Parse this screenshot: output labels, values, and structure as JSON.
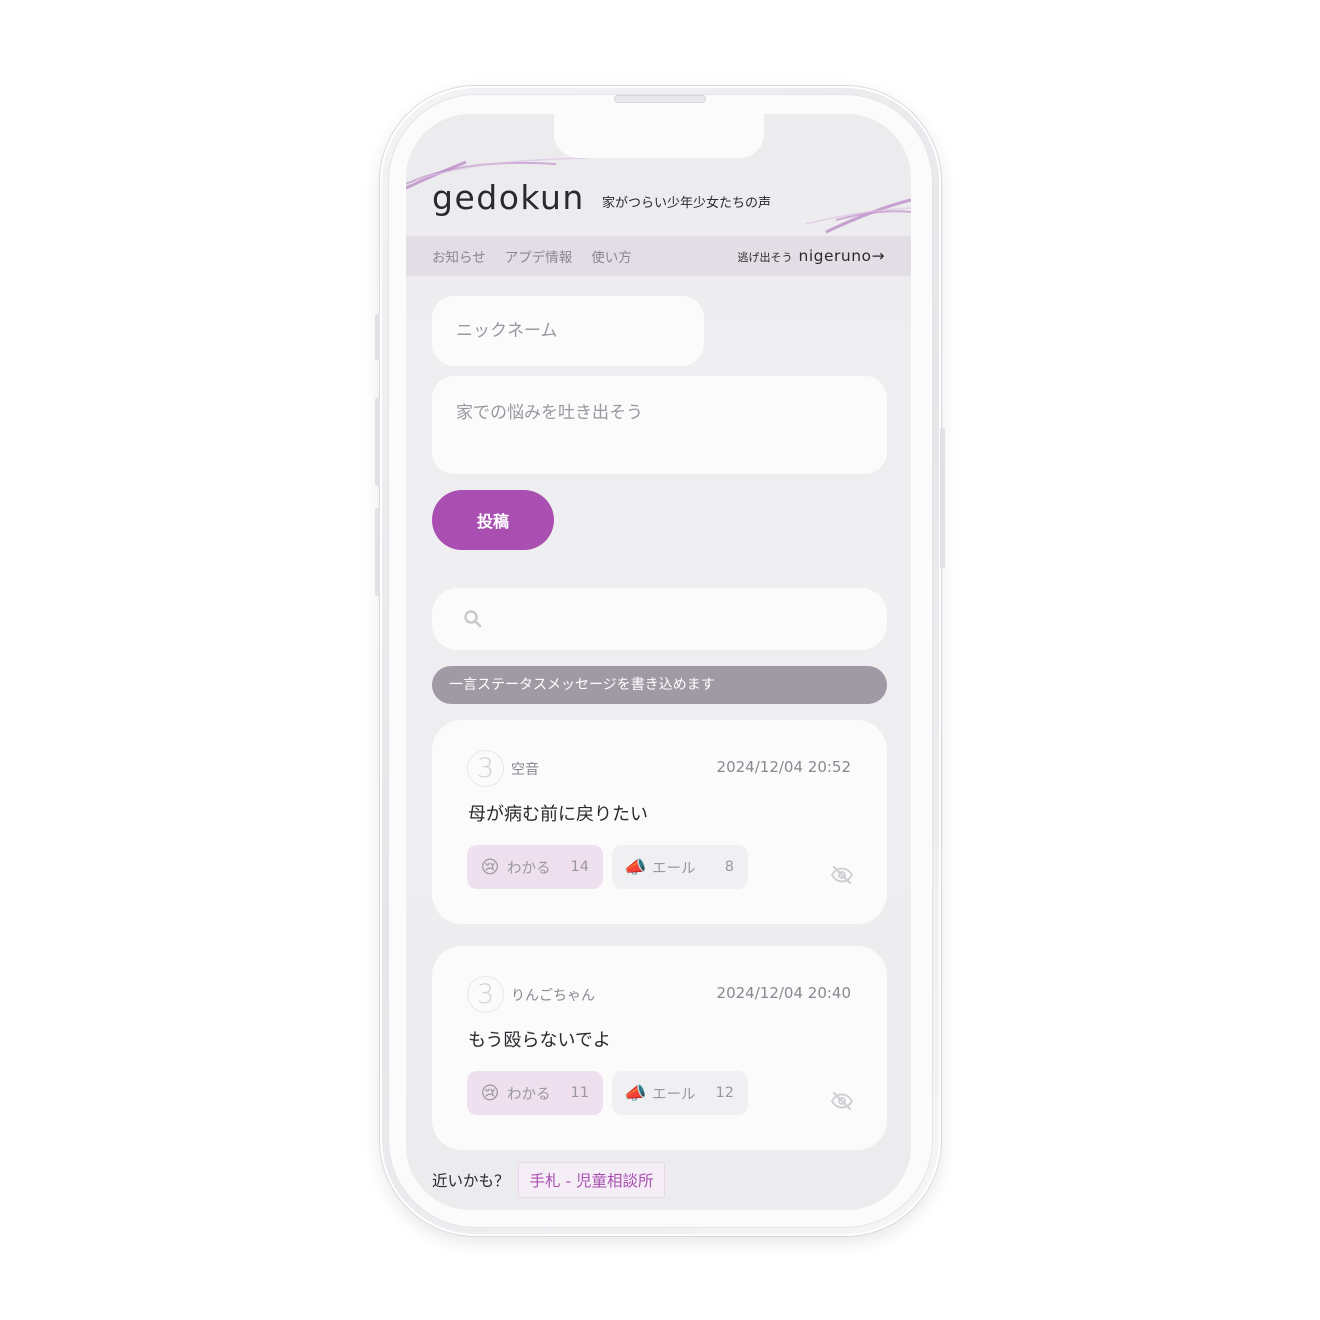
{
  "header": {
    "logo": "gedokun",
    "tagline": "家がつらい少年少女たちの声"
  },
  "nav": {
    "items": [
      "お知らせ",
      "アプデ情報",
      "使い方"
    ],
    "escape_prefix": "逃げ出そう",
    "escape_brand": "nigeruno→"
  },
  "form": {
    "nickname_placeholder": "ニックネーム",
    "worry_placeholder": "家での悩みを吐き出そう",
    "post_label": "投稿"
  },
  "status_message": "一言ステータスメッセージを書き込めます",
  "posts": [
    {
      "rank": "3",
      "author": "空音",
      "date": "2024/12/04 20:52",
      "message": "母が病む前に戻りたい",
      "wakaru_label": "わかる",
      "wakaru_count": "14",
      "yell_label": "エール",
      "yell_count": "8"
    },
    {
      "rank": "3",
      "author": "りんごちゃん",
      "date": "2024/12/04 20:40",
      "message": "もう殴らないでよ",
      "wakaru_label": "わかる",
      "wakaru_count": "11",
      "yell_label": "エール",
      "yell_count": "12"
    }
  ],
  "hint": {
    "label": "近いかも？",
    "link": "手札 - 児童相談所"
  },
  "colors": {
    "accent": "#a84fb1",
    "status_bg": "#a09aa4",
    "nav_bg": "#e3dee6"
  },
  "icons": {
    "search": "search-icon",
    "hide": "eye-off-icon",
    "wakaru": "crying-face-emoji",
    "yell": "megaphone-emoji"
  }
}
